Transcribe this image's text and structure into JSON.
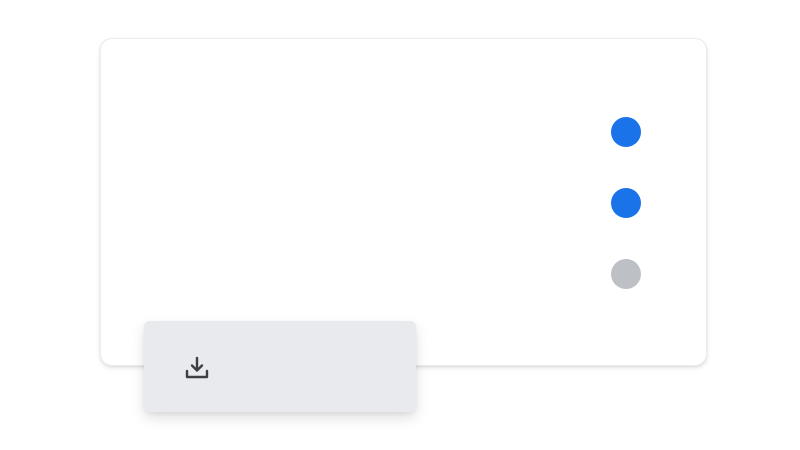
{
  "colors": {
    "background": "#ffffff",
    "card_background": "#ffffff",
    "dot_active": "#1a73e8",
    "dot_inactive": "#bdc1c6",
    "download_bar_background": "#e8eaed",
    "icon_color": "#3c4043"
  },
  "indicators": [
    {
      "state": "active",
      "color": "#1a73e8"
    },
    {
      "state": "active",
      "color": "#1a73e8"
    },
    {
      "state": "inactive",
      "color": "#bdc1c6"
    }
  ],
  "download_bar": {
    "icon": "download-icon"
  }
}
